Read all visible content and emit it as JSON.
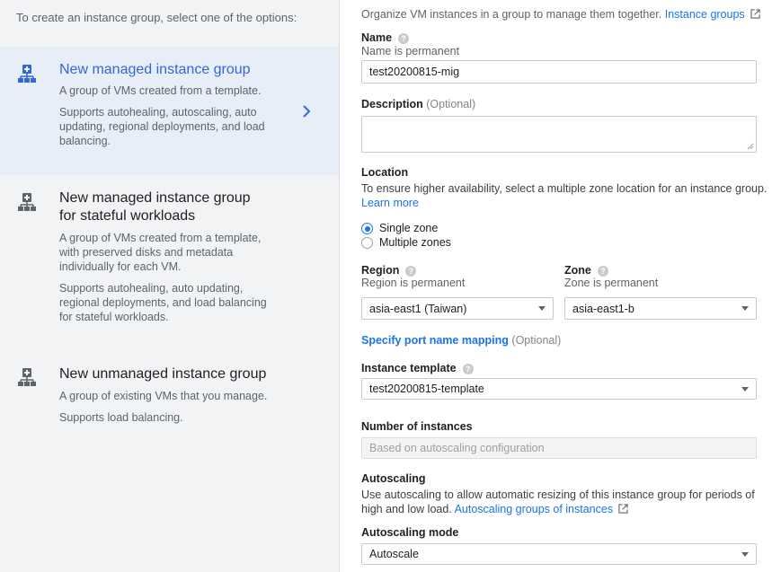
{
  "left": {
    "intro": "To create an instance group, select one of the options:",
    "options": [
      {
        "title": "New managed instance group",
        "desc1": "A group of VMs created from a template.",
        "desc2": "Supports autohealing, autoscaling, auto updating, regional deployments, and load balancing.",
        "icon": "instance-group-icon",
        "selected": true
      },
      {
        "title": "New managed instance group for stateful workloads",
        "desc1": "A group of VMs created from a template, with preserved disks and metadata individually for each VM.",
        "desc2": "Supports autohealing, auto updating, regional deployments, and load balancing for stateful workloads.",
        "icon": "instance-group-icon",
        "selected": false
      },
      {
        "title": "New unmanaged instance group",
        "desc1": "A group of existing VMs that you manage.",
        "desc2": "Supports load balancing.",
        "icon": "instance-group-icon",
        "selected": false
      }
    ]
  },
  "form": {
    "intro_text": "Organize VM instances in a group to manage them together.",
    "intro_link": "Instance groups",
    "name": {
      "label": "Name",
      "hint": "Name is permanent",
      "value": "test20200815-mig"
    },
    "description": {
      "label": "Description",
      "optional": "(Optional)",
      "value": ""
    },
    "location": {
      "label": "Location",
      "hint": "To ensure higher availability, select a multiple zone location for an instance group.",
      "learn_more": "Learn more",
      "single_zone": "Single zone",
      "multiple_zones": "Multiple zones",
      "selected": "single_zone"
    },
    "region": {
      "label": "Region",
      "hint": "Region is permanent",
      "value": "asia-east1 (Taiwan)"
    },
    "zone": {
      "label": "Zone",
      "hint": "Zone is permanent",
      "value": "asia-east1-b"
    },
    "port_mapping": {
      "link": "Specify port name mapping",
      "optional": "(Optional)"
    },
    "instance_template": {
      "label": "Instance template",
      "value": "test20200815-template"
    },
    "num_instances": {
      "label": "Number of instances",
      "placeholder": "Based on autoscaling configuration"
    },
    "autoscaling": {
      "label": "Autoscaling",
      "hint": "Use autoscaling to allow automatic resizing of this instance group for periods of",
      "hint2": "high and low load.",
      "link": "Autoscaling groups of instances"
    },
    "autoscaling_mode": {
      "label": "Autoscaling mode",
      "value": "Autoscale"
    }
  },
  "colors": {
    "accent": "#1a73e8",
    "selected_bg": "#e8eef8",
    "selected_title": "#3367d6",
    "panel_bg": "#f1f3f4"
  }
}
